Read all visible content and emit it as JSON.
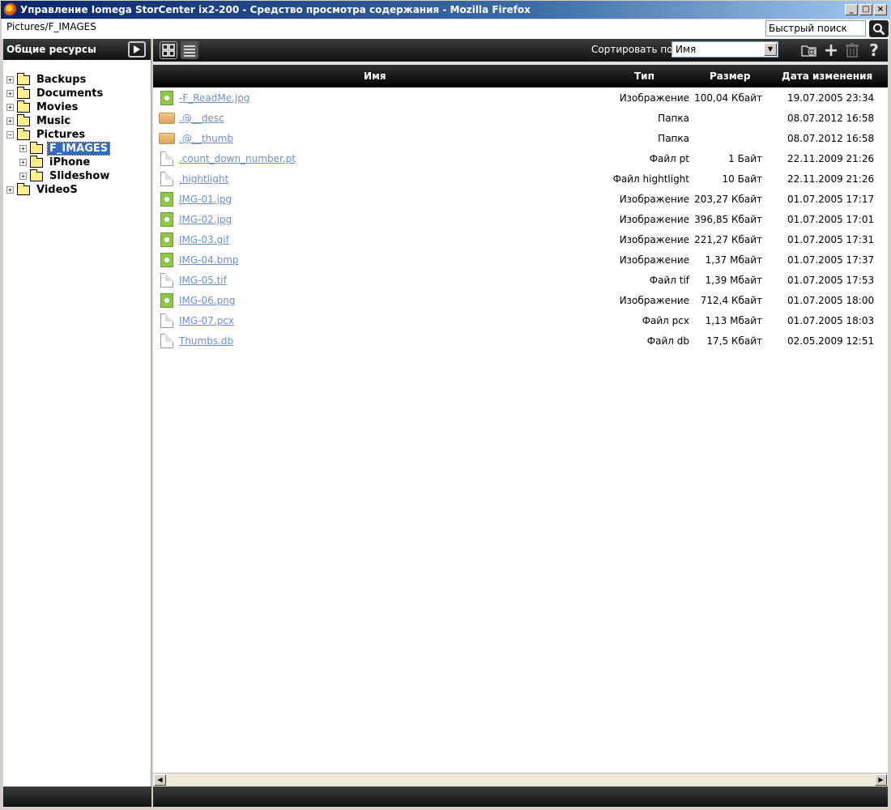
{
  "window": {
    "title": "Управление Iomega StorCenter ix2-200 - Средство просмотра содержания - Mozilla Firefox",
    "minimize": "_",
    "maximize": "□",
    "close": "×"
  },
  "topbar": {
    "path": "Pictures/F_IMAGES",
    "search_value": "Быстрый поиск"
  },
  "sidebar": {
    "header": "Общие ресурсы",
    "tree": [
      {
        "label": "Backups",
        "expander": "+"
      },
      {
        "label": "Documents",
        "expander": "+"
      },
      {
        "label": "Movies",
        "expander": "+"
      },
      {
        "label": "Music",
        "expander": "+"
      },
      {
        "label": "Pictures",
        "expander": "−"
      },
      {
        "label": "F_IMAGES",
        "expander": "+"
      },
      {
        "label": "iPhone",
        "expander": "+"
      },
      {
        "label": "Slideshow",
        "expander": "+"
      },
      {
        "label": "VideoS",
        "expander": "+"
      }
    ]
  },
  "toolbar": {
    "sort_label": "Сортировать по:",
    "sort_value": "Имя",
    "sort_arrow": "▼",
    "add_label": "+",
    "help_label": "?"
  },
  "columns": {
    "name": "Имя",
    "type": "Тип",
    "size": "Размер",
    "date": "Дата изменения"
  },
  "files": [
    {
      "name": "-F_ReadMe.jpg",
      "type": "Изображение",
      "size": "100,04 Кбайт",
      "date": "19.07.2005 23:34",
      "icon": "image"
    },
    {
      "name": ".@__desc",
      "type": "Папка",
      "size": "",
      "date": "08.07.2012 16:58",
      "icon": "folder"
    },
    {
      "name": ".@__thumb",
      "type": "Папка",
      "size": "",
      "date": "08.07.2012 16:58",
      "icon": "folder"
    },
    {
      "name": ".count_down_number.pt",
      "type": "Файл pt",
      "size": "1 Байт",
      "date": "22.11.2009 21:26",
      "icon": "doc"
    },
    {
      "name": ".hightlight",
      "type": "Файл hightlight",
      "size": "10 Байт",
      "date": "22.11.2009 21:26",
      "icon": "doc"
    },
    {
      "name": "IMG-01.jpg",
      "type": "Изображение",
      "size": "203,27 Кбайт",
      "date": "01.07.2005 17:17",
      "icon": "image"
    },
    {
      "name": "IMG-02.jpg",
      "type": "Изображение",
      "size": "396,85 Кбайт",
      "date": "01.07.2005 17:01",
      "icon": "image"
    },
    {
      "name": "IMG-03.gif",
      "type": "Изображение",
      "size": "221,27 Кбайт",
      "date": "01.07.2005 17:31",
      "icon": "image"
    },
    {
      "name": "IMG-04.bmp",
      "type": "Изображение",
      "size": "1,37 Мбайт",
      "date": "01.07.2005 17:37",
      "icon": "image"
    },
    {
      "name": "IMG-05.tif",
      "type": "Файл tif",
      "size": "1,39 Мбайт",
      "date": "01.07.2005 17:53",
      "icon": "doc"
    },
    {
      "name": "IMG-06.png",
      "type": "Изображение",
      "size": "712,4 Кбайт",
      "date": "01.07.2005 18:00",
      "icon": "image"
    },
    {
      "name": "IMG-07.pcx",
      "type": "Файл pcx",
      "size": "1,13 Мбайт",
      "date": "01.07.2005 18:03",
      "icon": "doc"
    },
    {
      "name": "Thumbs.db",
      "type": "Файл db",
      "size": "17,5 Кбайт",
      "date": "02.05.2009 12:51",
      "icon": "doc"
    }
  ],
  "scrollbar": {
    "left_arrow": "◀",
    "right_arrow": "▶"
  }
}
